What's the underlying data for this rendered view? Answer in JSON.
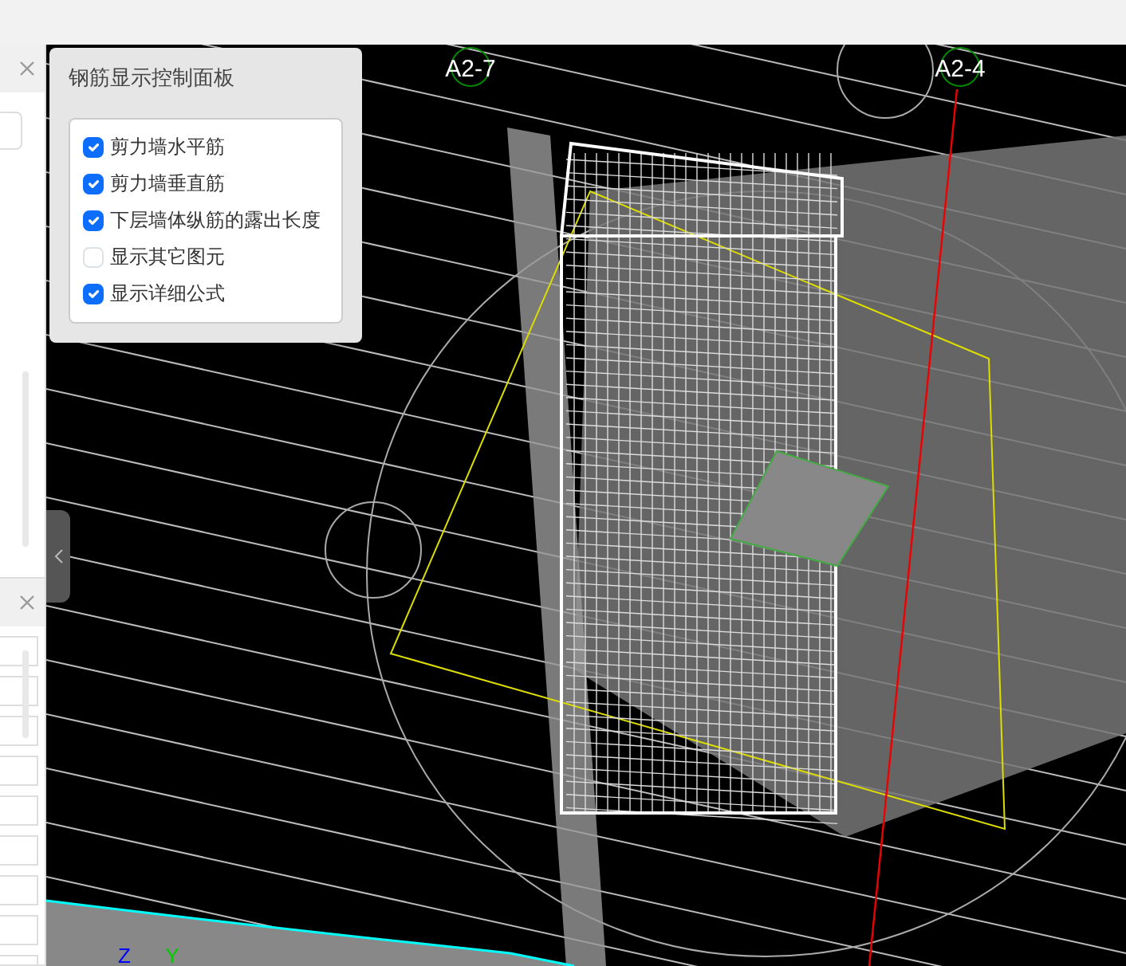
{
  "panel": {
    "title": "钢筋显示控制面板",
    "options": [
      {
        "label": "剪力墙水平筋",
        "checked": true
      },
      {
        "label": "剪力墙垂直筋",
        "checked": true
      },
      {
        "label": "下层墙体纵筋的露出长度",
        "checked": true
      },
      {
        "label": "显示其它图元",
        "checked": false
      },
      {
        "label": "显示详细公式",
        "checked": true
      }
    ]
  },
  "grid_labels": [
    "A2-7",
    "A2-4"
  ],
  "axis_labels": [
    "Z",
    "Y"
  ]
}
